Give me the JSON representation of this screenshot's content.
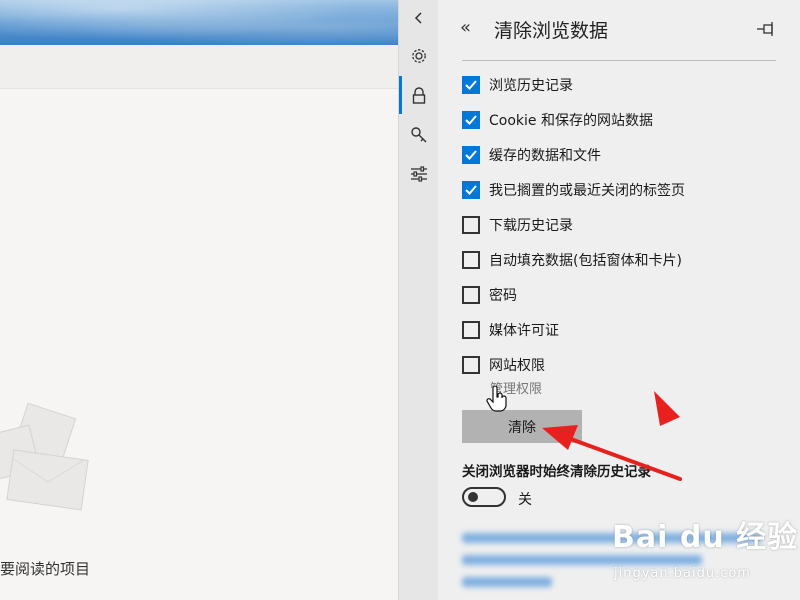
{
  "background_page": {
    "reading_list_text": "要阅读的项目"
  },
  "rail": {
    "items": [
      {
        "icon": "chevron-left-icon"
      },
      {
        "icon": "gear-icon"
      },
      {
        "icon": "lock-icon",
        "active": true
      },
      {
        "icon": "key-icon"
      },
      {
        "icon": "sliders-icon"
      }
    ]
  },
  "panel": {
    "back_glyph": "«",
    "title": "清除浏览数据",
    "options": [
      {
        "label": "浏览历史记录",
        "checked": true
      },
      {
        "label": "Cookie 和保存的网站数据",
        "checked": true
      },
      {
        "label": "缓存的数据和文件",
        "checked": true
      },
      {
        "label": "我已搁置的或最近关闭的标签页",
        "checked": true
      },
      {
        "label": "下载历史记录",
        "checked": false
      },
      {
        "label": "自动填充数据(包括窗体和卡片)",
        "checked": false
      },
      {
        "label": "密码",
        "checked": false
      },
      {
        "label": "媒体许可证",
        "checked": false
      },
      {
        "label": "网站权限",
        "checked": false
      }
    ],
    "manage_link": "管理权限",
    "clear_button": "清除",
    "always_clear_label": "关闭浏览器时始终清除历史记录",
    "toggle_state": "关",
    "toggle_on": false
  },
  "watermark": {
    "brand": "Bai du 经验",
    "url": "jingyan.baidu.com"
  },
  "colors": {
    "accent": "#0078d7",
    "annotation_arrow": "#e8201e",
    "panel_bg": "#efefef",
    "rail_bg": "#e6e6e6"
  }
}
